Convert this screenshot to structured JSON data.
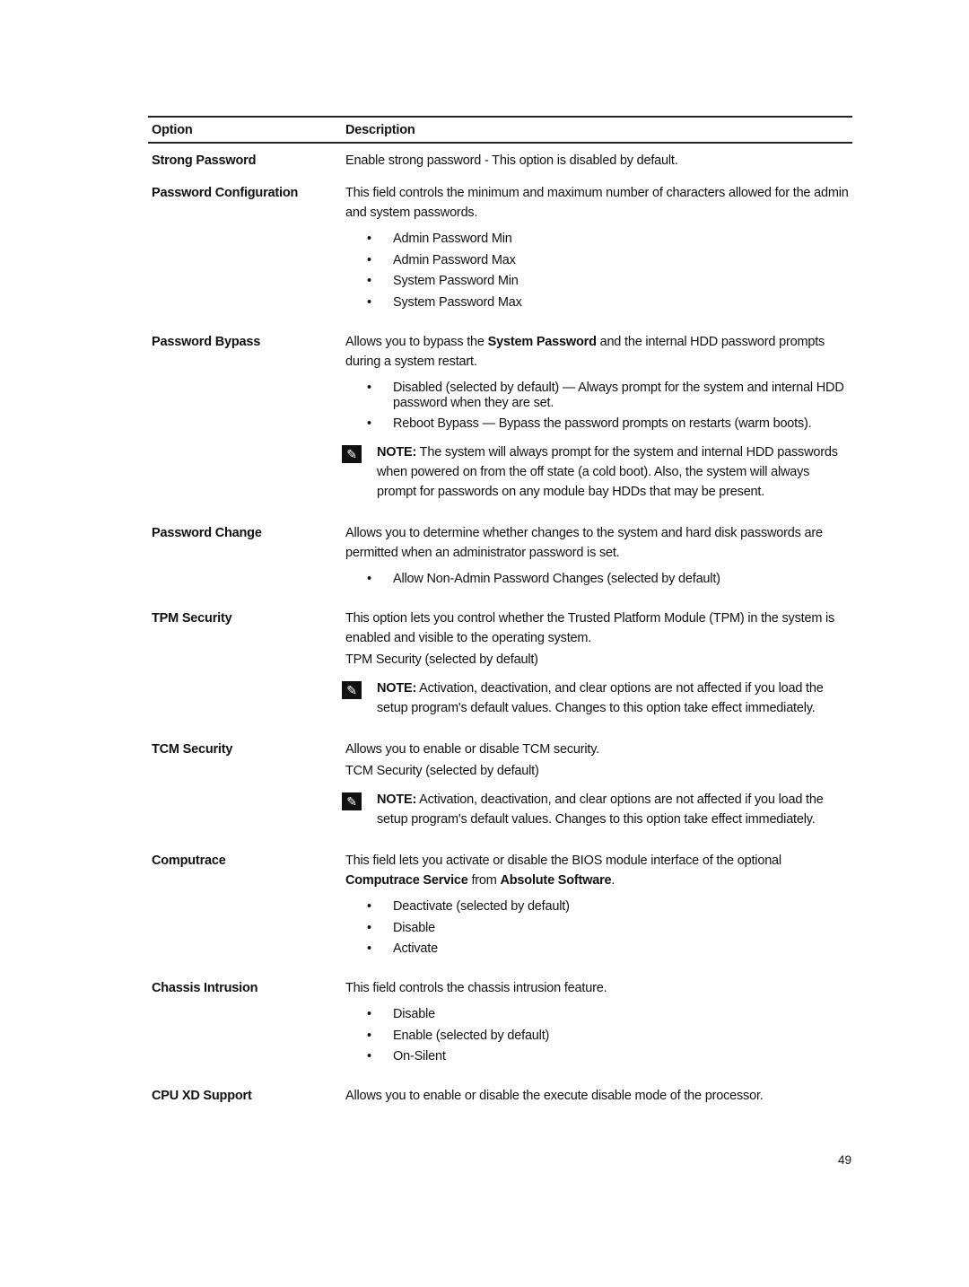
{
  "table": {
    "headers": {
      "option": "Option",
      "description": "Description"
    },
    "rows": [
      {
        "option": "Strong Password",
        "text": "Enable strong password - This option is disabled by default."
      },
      {
        "option": "Password Configuration",
        "text": "This field controls the minimum and maximum number of characters allowed for the admin and system passwords.",
        "bullets": [
          "Admin Password Min",
          "Admin Password Max",
          "System Password Min",
          "System Password Max"
        ]
      },
      {
        "option": "Password Bypass",
        "text_parts": [
          "Allows you to bypass the ",
          "System Password",
          " and the internal HDD password prompts during a system restart."
        ],
        "bullets": [
          "Disabled (selected by default) — Always prompt for the system and internal HDD password when they are set.",
          "Reboot Bypass — Bypass the password prompts on restarts (warm boots)."
        ],
        "note_label": "NOTE:",
        "note": " The system will always prompt for the system and internal HDD passwords when powered on from the off state (a cold boot). Also, the system will always prompt for passwords on any module bay HDDs that may be present."
      },
      {
        "option": "Password Change",
        "text": "Allows you to determine whether changes to the system and hard disk passwords are permitted when an administrator password is set.",
        "bullets": [
          "Allow Non-Admin Password Changes (selected by default)"
        ]
      },
      {
        "option": "TPM Security",
        "text": "This option lets you control whether the Trusted Platform Module (TPM) in the system is enabled and visible to the operating system.",
        "subtext": "TPM Security (selected by default)",
        "note_label": "NOTE:",
        "note": " Activation, deactivation, and clear options are not affected if you load the setup program's default values. Changes to this option take effect immediately."
      },
      {
        "option": "TCM Security",
        "text": "Allows you to enable or disable TCM security.",
        "subtext": "TCM Security (selected by default)",
        "note_label": "NOTE:",
        "note": " Activation, deactivation, and clear options are not affected if you load the setup program's default values. Changes to this option take effect immediately."
      },
      {
        "option": "Computrace",
        "text_parts": [
          "This field lets you activate or disable the BIOS module interface of the optional ",
          "Computrace Service",
          " from ",
          "Absolute Software",
          "."
        ],
        "bullets": [
          "Deactivate (selected by default)",
          "Disable",
          "Activate"
        ]
      },
      {
        "option": "Chassis Intrusion",
        "text": "This field controls the chassis intrusion feature.",
        "bullets": [
          "Disable",
          "Enable (selected by default)",
          "On-Silent"
        ]
      },
      {
        "option": "CPU XD Support",
        "text": "Allows you to enable or disable the execute disable mode of the processor."
      }
    ]
  },
  "icons": {
    "note": "pencil-note-icon"
  },
  "page_number": "49"
}
